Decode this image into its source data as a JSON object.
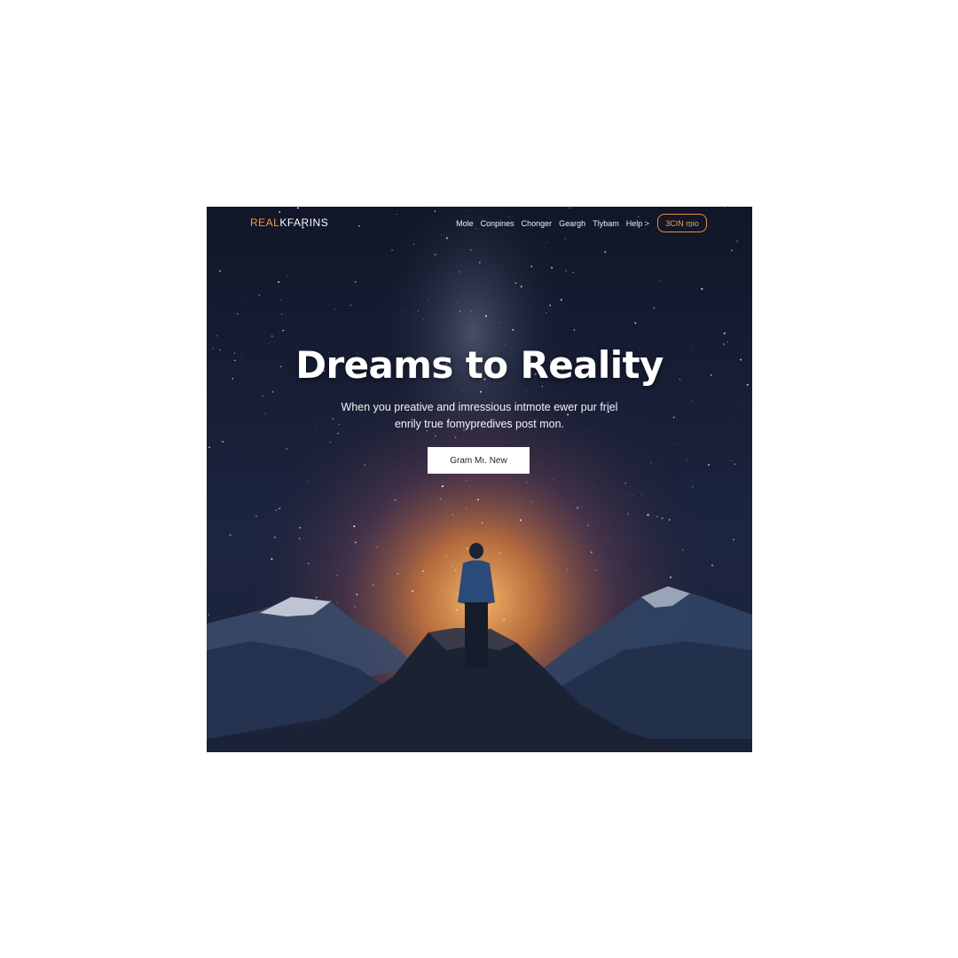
{
  "brand": {
    "prefix": "REAL",
    "suffix": "KFARINS",
    "accent_color": "#f29a3a"
  },
  "nav": {
    "links": [
      "Mole",
      "Conpines",
      "Chonger",
      "Geargh",
      "Tlybam",
      "Help >"
    ],
    "cta_label": "3CIN mio"
  },
  "hero": {
    "title": "Dreams to Reality",
    "subtitle_line1": "When you preative and imressious intmote ewer pur friel",
    "subtitle_line2": "enrily true fomypredives post mon.",
    "button_label": "Gram Mı. New",
    "background_icon": "starry-night-mountain-icon"
  }
}
